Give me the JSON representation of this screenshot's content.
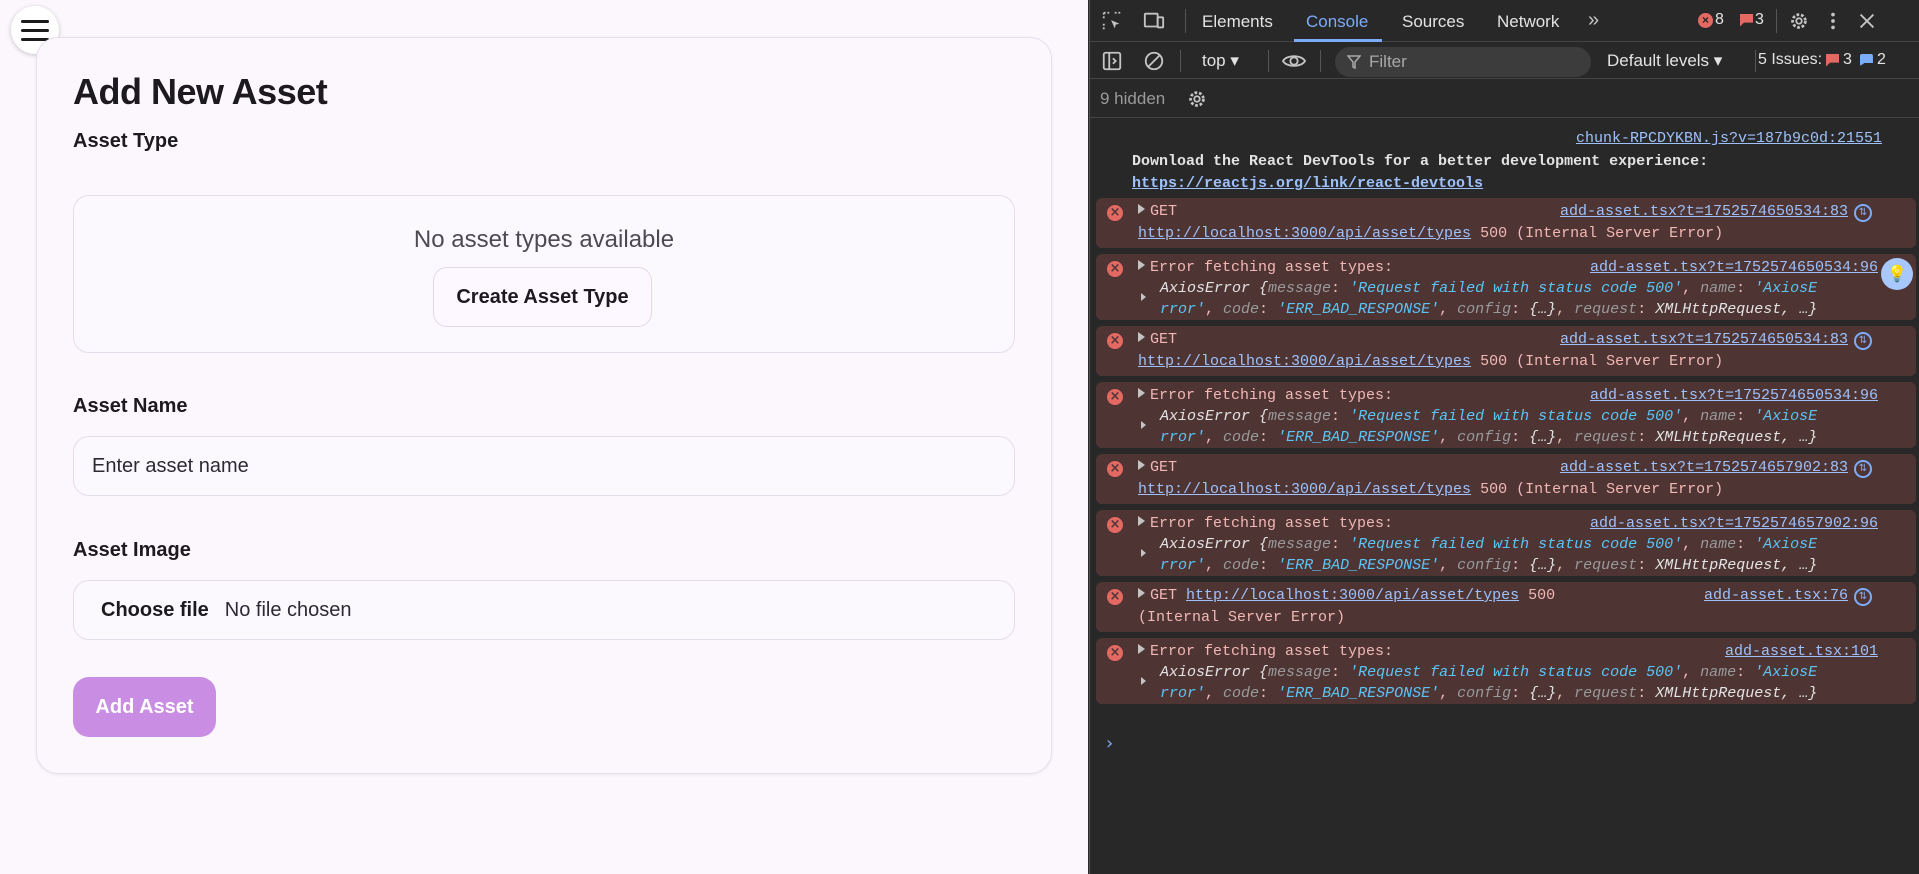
{
  "app": {
    "title": "Add New Asset",
    "asset_type": {
      "label": "Asset Type",
      "empty_message": "No asset types available",
      "create_button": "Create Asset Type"
    },
    "asset_name": {
      "label": "Asset Name",
      "placeholder": "Enter asset name"
    },
    "asset_image": {
      "label": "Asset Image",
      "choose_button": "Choose file",
      "file_status": "No file chosen"
    },
    "submit_button": "Add Asset",
    "accent_color": "#c98de3"
  },
  "devtools": {
    "tabs": [
      "Elements",
      "Console",
      "Sources",
      "Network"
    ],
    "active_tab": "Console",
    "error_count": "8",
    "warning_count": "3",
    "toolbar": {
      "context": "top",
      "filter_placeholder": "Filter",
      "levels": "Default levels",
      "issues_label": "5 Issues:",
      "issues_errors": "3",
      "issues_info": "2"
    },
    "hidden_label": "9 hidden",
    "info_log": {
      "source": "chunk-RPCDYKBN.js?v=187b9c0d:21551",
      "line1": "Download the React DevTools for a better development experience:",
      "link": "https://reactjs.org/link/react-devtools"
    },
    "get_error": {
      "method": "GET",
      "url": "http://localhost:3000/api/asset/types",
      "status": "500 (Internal Server Error)",
      "status_code": "500",
      "status_text": "(Internal Server Error)"
    },
    "fetch_error": {
      "message": "Error fetching asset types:",
      "axios_prefix": "AxiosError {",
      "k_message": "message",
      "v_message": "'Request failed with status code 500'",
      "k_name": "name",
      "v_name_a": "'AxiosE",
      "v_name_b": "rror'",
      "k_code": "code",
      "v_code": "'ERR_BAD_RESPONSE'",
      "k_config": "config",
      "v_config": "{…}",
      "k_request": "request",
      "v_request": "XMLHttpRequest, …}"
    },
    "sources": {
      "s1": "add-asset.tsx?t=1752574650534:83",
      "s2": "add-asset.tsx?t=1752574650534:96",
      "s3": "add-asset.tsx?t=1752574657902:83",
      "s4": "add-asset.tsx?t=1752574657902:96",
      "s5": "add-asset.tsx:76",
      "s6": "add-asset.tsx:101"
    }
  }
}
